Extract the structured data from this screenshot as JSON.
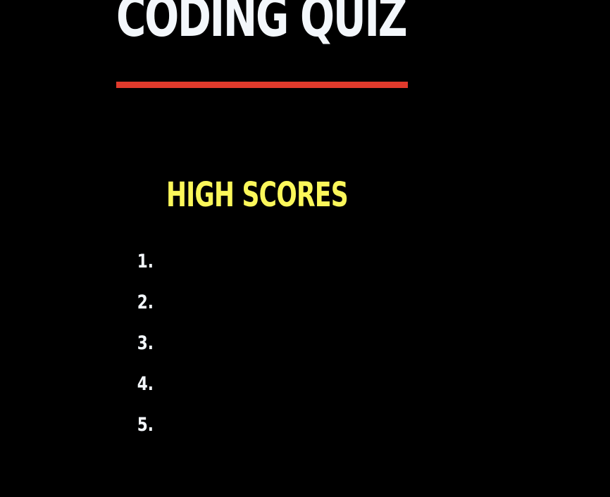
{
  "header": {
    "title": "CODING QUIZ"
  },
  "scores": {
    "heading": "HIGH SCORES",
    "items": [
      {
        "rank": "1.",
        "entry": ""
      },
      {
        "rank": "2.",
        "entry": ""
      },
      {
        "rank": "3.",
        "entry": ""
      },
      {
        "rank": "4.",
        "entry": ""
      },
      {
        "rank": "5.",
        "entry": ""
      }
    ]
  },
  "colors": {
    "background": "#000000",
    "title": "#f3f7fb",
    "accent_rule": "#e03a2c",
    "heading": "#fbf75a"
  }
}
